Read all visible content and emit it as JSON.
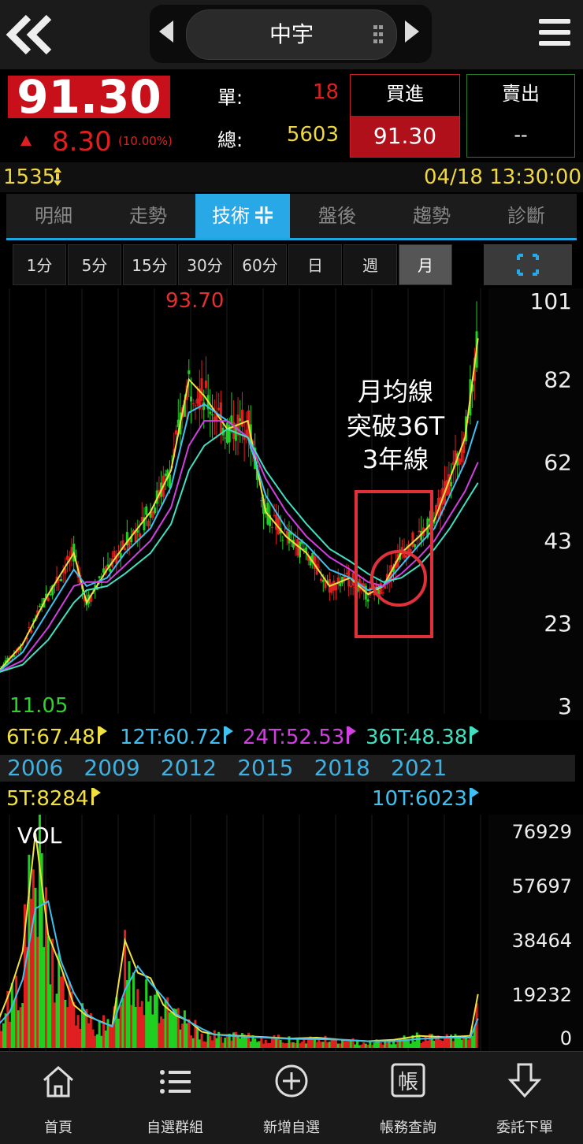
{
  "header": {
    "stock_name": "中宇",
    "icons": {
      "back": "double-chevron-left-icon",
      "prev": "triangle-left-icon",
      "next": "triangle-right-icon",
      "menu": "hamburger-icon"
    }
  },
  "quote": {
    "price": "91.30",
    "change": "8.30",
    "change_pct": "(10.00%)",
    "unit_label": "單:",
    "unit_value": "18",
    "total_label": "總:",
    "total_value": "5603",
    "buy_label": "買進",
    "buy_price": "91.30",
    "sell_label": "賣出",
    "sell_price": "--",
    "up_color": "#e02020"
  },
  "info": {
    "code": "1535",
    "datetime": "04/18 13:30:00"
  },
  "tabs": [
    {
      "label": "明細"
    },
    {
      "label": "走勢"
    },
    {
      "label": "技術"
    },
    {
      "label": "盤後"
    },
    {
      "label": "趨勢"
    },
    {
      "label": "診斷"
    }
  ],
  "periods": [
    {
      "label": "1分"
    },
    {
      "label": "5分"
    },
    {
      "label": "15分"
    },
    {
      "label": "30分"
    },
    {
      "label": "60分"
    },
    {
      "label": "日"
    },
    {
      "label": "週"
    },
    {
      "label": "月"
    }
  ],
  "chart_data": [
    {
      "type": "line",
      "high_label": "93.70",
      "low_label": "11.05",
      "y_ticks": [
        "101",
        "82",
        "62",
        "43",
        "23",
        "3"
      ],
      "ylim": [
        3,
        101
      ],
      "x_ticks": [
        "2006",
        "2009",
        "2012",
        "2015",
        "2018",
        "2021"
      ],
      "annotation": [
        "月均線",
        "突破36T",
        "3年線"
      ],
      "x": [
        2004.5,
        2005.5,
        2006.5,
        2007.5,
        2008,
        2008.8,
        2009.5,
        2010.5,
        2011.3,
        2012,
        2012.6,
        2013.5,
        2014.3,
        2015,
        2015.8,
        2016.6,
        2017.5,
        2018.3,
        2019,
        2019.6,
        2020.3,
        2021,
        2021.6,
        2022.2,
        2022.8,
        2023.3
      ],
      "series": [
        {
          "name": "6T",
          "color": "#f0e040",
          "values": [
            11,
            18,
            30,
            40,
            28,
            36,
            42,
            50,
            60,
            82,
            78,
            70,
            72,
            50,
            44,
            40,
            32,
            34,
            30,
            32,
            40,
            44,
            48,
            58,
            68,
            92
          ]
        },
        {
          "name": "12T",
          "color": "#40c0f0",
          "values": [
            11,
            16,
            26,
            36,
            32,
            34,
            40,
            46,
            56,
            74,
            76,
            72,
            68,
            54,
            46,
            42,
            36,
            34,
            31,
            32,
            37,
            42,
            46,
            54,
            62,
            72
          ]
        },
        {
          "name": "24T",
          "color": "#d040e0",
          "values": [
            11,
            14,
            22,
            32,
            33,
            33,
            37,
            43,
            51,
            66,
            72,
            72,
            68,
            58,
            50,
            44,
            39,
            36,
            33,
            32,
            35,
            39,
            43,
            49,
            55,
            62
          ]
        },
        {
          "name": "36T",
          "color": "#40e0c0",
          "values": [
            11,
            13,
            19,
            28,
            31,
            32,
            35,
            40,
            47,
            60,
            66,
            70,
            68,
            60,
            53,
            47,
            41,
            38,
            35,
            33,
            34,
            37,
            41,
            46,
            52,
            57
          ]
        }
      ],
      "ma_legend": [
        {
          "label": "6T:67.48",
          "color": "#f0e040"
        },
        {
          "label": "12T:60.72",
          "color": "#40c0f0"
        },
        {
          "label": "24T:52.53",
          "color": "#d040e0"
        },
        {
          "label": "36T:48.38",
          "color": "#40e0c0"
        }
      ]
    },
    {
      "type": "bar",
      "title": "VOL",
      "y_ticks": [
        "76929",
        "57697",
        "38464",
        "19232",
        "0"
      ],
      "ylim": [
        0,
        76929
      ],
      "ma_legend": [
        {
          "label": "5T:8284",
          "color": "#f0e040"
        },
        {
          "label": "10T:6023",
          "color": "#40c0f0"
        }
      ],
      "x": [
        2004.5,
        2005,
        2005.5,
        2006,
        2006.5,
        2007,
        2007.5,
        2008,
        2008.5,
        2009,
        2009.5,
        2010,
        2010.5,
        2011,
        2011.5,
        2012,
        2012.5,
        2013,
        2014,
        2015,
        2016,
        2017,
        2018,
        2019,
        2020,
        2021,
        2022,
        2023,
        2023.3
      ],
      "values": [
        9000,
        21000,
        36000,
        80000,
        42000,
        30000,
        16000,
        12000,
        10000,
        8000,
        40000,
        28000,
        26000,
        16000,
        12000,
        10000,
        6000,
        5000,
        4500,
        4000,
        3500,
        3800,
        3000,
        2500,
        3000,
        4500,
        4000,
        4500,
        20000
      ]
    }
  ],
  "bottom_nav": [
    {
      "label": "首頁",
      "icon": "home-icon"
    },
    {
      "label": "自選群組",
      "icon": "list-icon"
    },
    {
      "label": "新增自選",
      "icon": "plus-circle-icon"
    },
    {
      "label": "帳務查詢",
      "icon": "account-icon",
      "glyph": "帳"
    },
    {
      "label": "委託下單",
      "icon": "down-arrow-icon"
    }
  ]
}
